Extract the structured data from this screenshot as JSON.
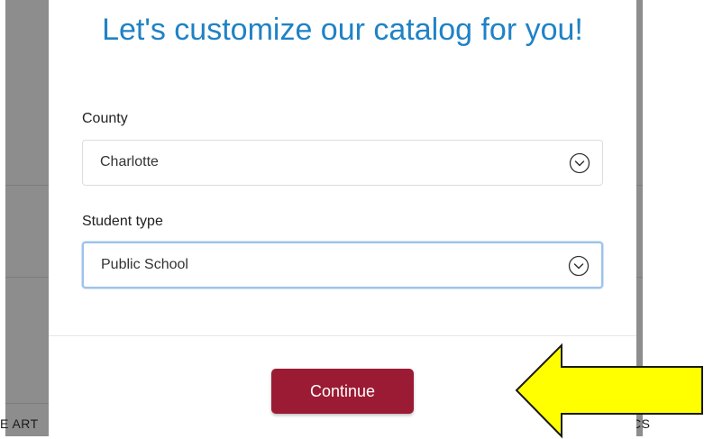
{
  "background": {
    "left_text": "E ART",
    "right_text": "CS"
  },
  "modal": {
    "title": "Let's customize our catalog for you!",
    "county": {
      "label": "County",
      "value": "Charlotte"
    },
    "student_type": {
      "label": "Student type",
      "value": "Public School"
    },
    "continue_label": "Continue"
  },
  "colors": {
    "title": "#1f82c6",
    "button": "#9b1b34",
    "arrow_fill": "#ffff00",
    "focus_border": "#9ec3ea"
  },
  "icons": {
    "select_chevron": "chevron-down-circle-icon",
    "annotation": "arrow-left-icon"
  }
}
